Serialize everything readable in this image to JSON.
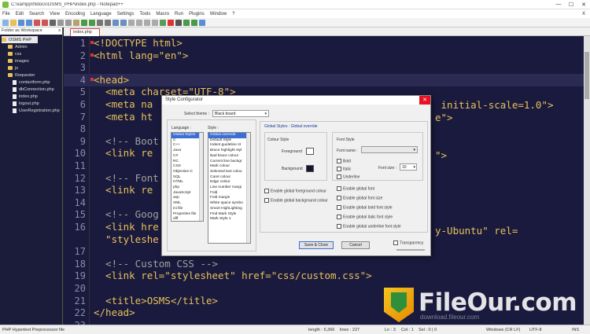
{
  "window": {
    "title": "C:\\xampp\\htdocs\\OSMS_PHP\\index.php - Notepad++",
    "minimize": "—",
    "maximize": "☐",
    "close": "✕"
  },
  "menu": [
    "File",
    "Edit",
    "Search",
    "View",
    "Encoding",
    "Language",
    "Settings",
    "Tools",
    "Macro",
    "Run",
    "Plugins",
    "Window",
    "?"
  ],
  "menu_close": "X",
  "workspace": {
    "title": "Folder as Workspace",
    "close": "x",
    "items": [
      {
        "label": "OSMS PHP",
        "kind": "root"
      },
      {
        "label": "Admin",
        "kind": "folder"
      },
      {
        "label": "css",
        "kind": "folder"
      },
      {
        "label": "images",
        "kind": "folder"
      },
      {
        "label": "js",
        "kind": "folder"
      },
      {
        "label": "Requester",
        "kind": "folder"
      },
      {
        "label": "contactform.php",
        "kind": "file"
      },
      {
        "label": "dbConnection.php",
        "kind": "file"
      },
      {
        "label": "index.php",
        "kind": "file"
      },
      {
        "label": "logout.php",
        "kind": "file"
      },
      {
        "label": "UserRegistration.php",
        "kind": "file"
      }
    ]
  },
  "tab": {
    "label": "index.php"
  },
  "editor": {
    "lines": [
      {
        "n": "1",
        "text": "<!DOCTYPE html>",
        "cls": "c-tag",
        "mark": true
      },
      {
        "n": "2",
        "text": "<html lang=\"en\">",
        "cls": "c-tag",
        "mark": true
      },
      {
        "n": "3",
        "text": "",
        "cls": "",
        "mark": false
      },
      {
        "n": "4",
        "text": "<head>",
        "cls": "c-tag",
        "mark": true,
        "current": true
      },
      {
        "n": "5",
        "text": "  <meta charset=\"UTF-8\">",
        "cls": "c-tag",
        "mark": false
      },
      {
        "n": "6",
        "text": "  <meta na",
        "cls": "c-tag",
        "mark": false
      },
      {
        "n": "7",
        "text": "  <meta ht",
        "cls": "c-tag",
        "mark": false
      },
      {
        "n": "8",
        "text": "",
        "cls": "",
        "mark": false
      },
      {
        "n": "9",
        "text": "  <!-- Boot",
        "cls": "c-com",
        "mark": false
      },
      {
        "n": "10",
        "text": "  <link re",
        "cls": "c-tag",
        "mark": false
      },
      {
        "n": "11",
        "text": "",
        "cls": "",
        "mark": false
      },
      {
        "n": "12",
        "text": "  <!-- Font",
        "cls": "c-com",
        "mark": false
      },
      {
        "n": "13",
        "text": "  <link re",
        "cls": "c-tag",
        "mark": false
      },
      {
        "n": "14",
        "text": "",
        "cls": "",
        "mark": false
      },
      {
        "n": "15",
        "text": "  <!-- Goog",
        "cls": "c-com",
        "mark": false
      },
      {
        "n": "16",
        "text": "  <link hre",
        "cls": "c-tag",
        "mark": false
      },
      {
        "n": "",
        "text": "  \"styleshe",
        "cls": "c-str",
        "mark": false
      },
      {
        "n": "17",
        "text": "",
        "cls": "",
        "mark": false
      },
      {
        "n": "18",
        "text": "  <!-- Custom CSS -->",
        "cls": "c-com",
        "mark": false
      },
      {
        "n": "19",
        "text": "  <link rel=\"stylesheet\" href=\"css/custom.css\">",
        "cls": "c-tag",
        "mark": false
      },
      {
        "n": "20",
        "text": "",
        "cls": "",
        "mark": false
      },
      {
        "n": "21",
        "text": "  <title>OSMS</title>",
        "cls": "c-tag",
        "mark": false
      },
      {
        "n": "22",
        "text": "</head>",
        "cls": "c-tag",
        "mark": false
      },
      {
        "n": "23",
        "text": "",
        "cls": "",
        "mark": false
      }
    ],
    "right_fragments": {
      "line6": " initial-scale=1.0\">",
      "line7": "e\">",
      "line10": "\">",
      "line16": "y-Ubuntu\" rel="
    }
  },
  "dialog": {
    "title": "Style Configurator",
    "close": "✕",
    "select_theme_label": "Select theme :",
    "select_theme_value": "Black board",
    "language_label": "Language :",
    "style_label": "Style :",
    "languages": [
      "Global Styles",
      "C",
      "C++",
      "Java",
      "C#",
      "RC",
      "CSS",
      "Objective-C",
      "SQL",
      "HTML",
      "php",
      "JavaScript",
      "asp",
      "XML",
      "ini file",
      "Properties file",
      "diff",
      "DOS Style"
    ],
    "styles": [
      "Global override",
      "Default Style",
      "Indent guideline st",
      "Brace highlight styl",
      "Bad brace colour",
      "Current line backgr",
      "Mark colour",
      "Selected text colou",
      "Caret colour",
      "Edge colour",
      "Line number margi",
      "Fold",
      "Fold margin",
      "White space symbo",
      "Smart HighLighting",
      "Find Mark Style",
      "Mark Style 1"
    ],
    "section_title": "Global Styles : Global override",
    "colour_style_label": "Colour Style",
    "foreground_label": "Foreground",
    "background_label": "Background",
    "font_style_label": "Font Style",
    "font_name_label": "Font name :",
    "bold_label": "Bold",
    "italic_label": "Italic",
    "underline_label": "Underline",
    "font_size_label": "Font size :",
    "font_size_value": "10",
    "enable_fg_label": "Enable global foreground colour",
    "enable_bg_label": "Enable global background colour",
    "enable_checks": [
      "Enable global font",
      "Enable global font size",
      "Enable global bold font style",
      "Enable global italic font style",
      "Enable global underline font style"
    ],
    "save_button": "Save & Close",
    "cancel_button": "Cancel",
    "transparency_label": "Transparency"
  },
  "status": {
    "filetype": "PHP Hypertext Preprocessor file",
    "length": "length : 5,366",
    "lines": "lines : 227",
    "ln": "Ln : 3",
    "col": "Col : 1",
    "sel": "Sel : 0 | 0",
    "eol": "Windows (CR LF)",
    "encoding": "UTF-8",
    "mode": "INS"
  },
  "watermark": {
    "text": "FileOur.com",
    "sub": "download.fileour.com"
  },
  "colors": {
    "editor_bg": "#1a1a3e",
    "tag": "#e6c15a",
    "comment": "#a0a0a0",
    "accent": "#3b6fd6"
  }
}
